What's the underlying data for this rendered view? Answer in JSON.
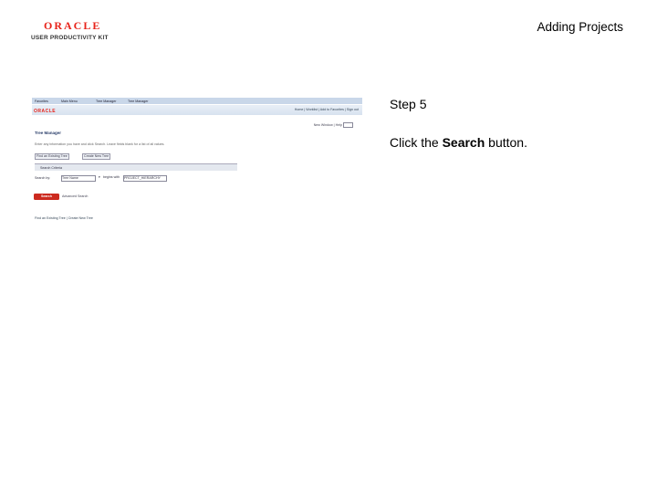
{
  "logo": {
    "brand": "ORACLE",
    "product": "USER PRODUCTIVITY KIT"
  },
  "document": {
    "title": "Adding Projects"
  },
  "step": {
    "title": "Step 5",
    "instruction_prefix": "Click the ",
    "instruction_target": "Search",
    "instruction_suffix": " button."
  },
  "screenshot": {
    "topbar": [
      "Favorites",
      "Main Menu",
      "Tree Manager",
      "Tree Manager"
    ],
    "nav_logo": "ORACLE",
    "nav_links": "Home  |  Worklist  |  Add to Favorites  |  Sign out",
    "right_line": "New Window | Help",
    "page_heading": "Tree Manager",
    "description": "Enter any information you have and click Search. Leave fields blank for a list of all values.",
    "tabs": [
      "Find an Existing Tree",
      "Create New Tree"
    ],
    "criteria_label": "Search Criteria",
    "search_by_label": "Search by:",
    "search_by_value": "Tree Name",
    "operator_value": "begins with",
    "search_value": "PROJECT_HIERARCHY",
    "search_button": "Search",
    "advanced_link": "Advanced Search",
    "footer": "Find an Existing Tree | Create New Tree"
  }
}
